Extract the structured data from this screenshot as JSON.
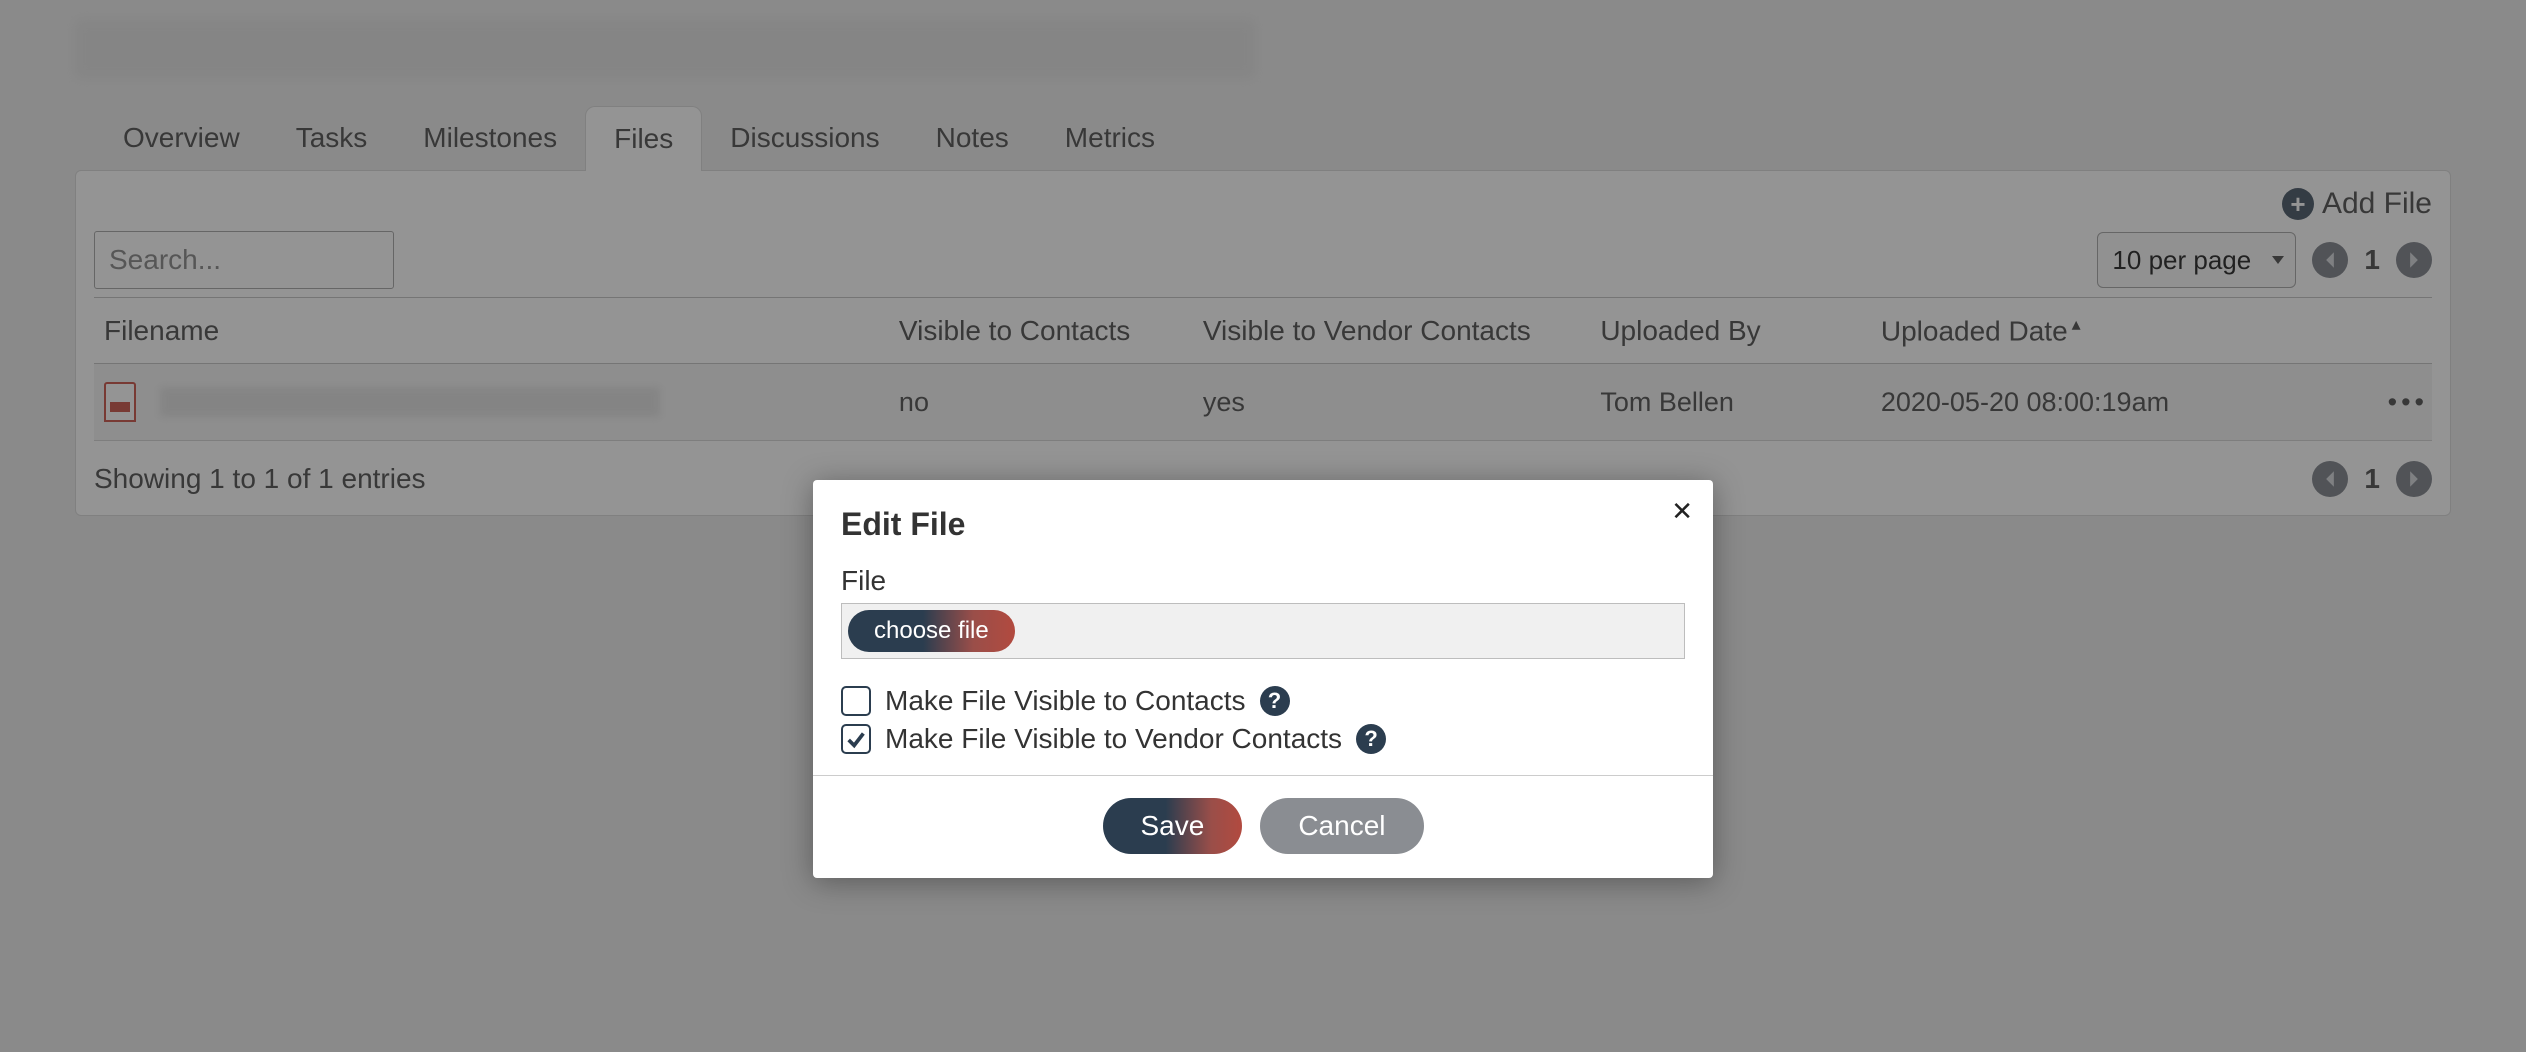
{
  "tabs": {
    "overview": "Overview",
    "tasks": "Tasks",
    "milestones": "Milestones",
    "files": "Files",
    "discussions": "Discussions",
    "notes": "Notes",
    "metrics": "Metrics",
    "active": "files"
  },
  "toolbar": {
    "add_file": "Add File",
    "search_placeholder": "Search...",
    "per_page_value": "10 per page",
    "page_number": "1"
  },
  "table": {
    "columns": {
      "filename": "Filename",
      "visible_contacts": "Visible to Contacts",
      "visible_vendor_contacts": "Visible to Vendor Contacts",
      "uploaded_by": "Uploaded By",
      "uploaded_date": "Uploaded Date"
    },
    "rows": [
      {
        "visible_contacts": "no",
        "visible_vendor_contacts": "yes",
        "uploaded_by": "Tom Bellen",
        "uploaded_date": "2020-05-20 08:00:19am"
      }
    ],
    "showing_text": "Showing 1 to 1 of 1 entries"
  },
  "modal": {
    "title": "Edit File",
    "file_label": "File",
    "choose_file_label": "choose file",
    "check_visible_contacts": {
      "label": "Make File Visible to Contacts",
      "checked": false
    },
    "check_visible_vendor_contacts": {
      "label": "Make File Visible to Vendor Contacts",
      "checked": true
    },
    "save_label": "Save",
    "cancel_label": "Cancel",
    "close_glyph": "✕"
  }
}
